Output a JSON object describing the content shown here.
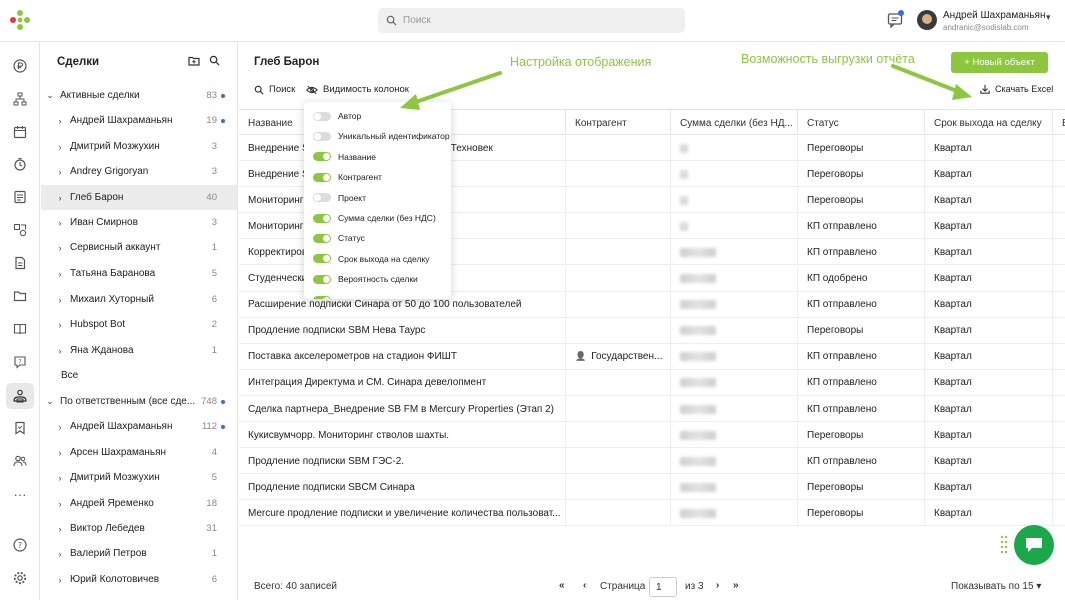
{
  "header": {
    "search_placeholder": "Поиск",
    "user_name": "Андрей Шахраманьян",
    "user_email": "andranic@sodislab.com"
  },
  "deals": {
    "title": "Сделки",
    "rows": [
      {
        "label": "Активные сделки",
        "count": "83",
        "dot": true,
        "expanded": true,
        "level": 0
      },
      {
        "label": "Андрей Шахраманьян",
        "count": "19",
        "dot": true,
        "level": 1
      },
      {
        "label": "Дмитрий Мозжухин",
        "count": "3",
        "dot": false,
        "level": 1
      },
      {
        "label": "Andrey Grigoryan",
        "count": "3",
        "dot": false,
        "level": 1
      },
      {
        "label": "Глеб Барон",
        "count": "40",
        "dot": false,
        "level": 1,
        "selected": true
      },
      {
        "label": "Иван Смирнов",
        "count": "3",
        "dot": false,
        "level": 1
      },
      {
        "label": "Сервисный аккаунт",
        "count": "1",
        "dot": false,
        "level": 1
      },
      {
        "label": "Татьяна Баранова",
        "count": "5",
        "dot": false,
        "level": 1
      },
      {
        "label": "Михаил Хуторный",
        "count": "6",
        "dot": false,
        "level": 1
      },
      {
        "label": "Hubspot Bot",
        "count": "2",
        "dot": false,
        "level": 1
      },
      {
        "label": "Яна Жданова",
        "count": "1",
        "dot": false,
        "level": 1
      },
      {
        "label": "Все",
        "count": "",
        "dot": false,
        "level": 2
      },
      {
        "label": "По ответственным (все сде...",
        "count": "748",
        "dot": true,
        "expanded": true,
        "level": 0
      },
      {
        "label": "Андрей Шахраманьян",
        "count": "112",
        "dot": true,
        "level": 1
      },
      {
        "label": "Арсен Шахраманьян",
        "count": "4",
        "dot": false,
        "level": 1
      },
      {
        "label": "Дмитрий Мозжухин",
        "count": "5",
        "dot": false,
        "level": 1
      },
      {
        "label": "Андрей Яременко",
        "count": "18",
        "dot": false,
        "level": 1
      },
      {
        "label": "Виктор Лебедев",
        "count": "31",
        "dot": false,
        "level": 1
      },
      {
        "label": "Валерий Петров",
        "count": "1",
        "dot": false,
        "level": 1
      },
      {
        "label": "Юрий Колотовичев",
        "count": "6",
        "dot": false,
        "level": 1
      }
    ]
  },
  "main": {
    "title": "Глеб Барон",
    "new_button": "+ Новый объект",
    "search_label": "Поиск",
    "columns_label": "Видимость колонок",
    "excel_label": "Скачать Excel",
    "columns": [
      "Название",
      "Контрагент",
      "Сумма сделки (без НД...",
      "Статус",
      "Срок выхода на сделку"
    ],
    "rows": [
      {
        "name": "Внедрение SB FM в Московский НИИ. НГО Техновек",
        "ctr": "",
        "sum": "short",
        "status": "Переговоры",
        "term": "Квартал"
      },
      {
        "name": "Внедрение SB FM",
        "ctr": "",
        "sum": "short",
        "status": "Переговоры",
        "term": "Квартал"
      },
      {
        "name": "Мониторинг",
        "ctr": "",
        "sum": "short",
        "status": "Переговоры",
        "term": "Квартал"
      },
      {
        "name": "Мониторинг вл. 21, стр.53-54, Бивер",
        "ctr": "",
        "sum": "short",
        "status": "КП отправлено",
        "term": "Квартал"
      },
      {
        "name": "Корректировка ела СМК по объекту «...",
        "ctr": "",
        "sum": "long",
        "status": "КП отправлено",
        "term": "Квартал"
      },
      {
        "name": "Студенческий проект",
        "ctr": "",
        "sum": "long",
        "status": "КП одобрено",
        "term": "Квартал"
      },
      {
        "name": "Расширение подписки Синара от 50 до 100 пользователей",
        "ctr": "",
        "sum": "long",
        "status": "КП отправлено",
        "term": "Квартал"
      },
      {
        "name": "Продление подписки SBM Нева Таурс",
        "ctr": "",
        "sum": "long",
        "status": "Переговоры",
        "term": "Квартал"
      },
      {
        "name": "Поставка акселерометров на стадион ФИШТ",
        "ctr": "Государствен...",
        "sum": "long",
        "status": "КП отправлено",
        "term": "Квартал"
      },
      {
        "name": "Интеграция Директума и СМ. Синара девелопмент",
        "ctr": "",
        "sum": "long",
        "status": "КП отправлено",
        "term": "Квартал"
      },
      {
        "name": "Сделка партнера_Внедрение SB FM в Mercury Properties (Этап 2)",
        "ctr": "",
        "sum": "long",
        "status": "КП отправлено",
        "term": "Квартал"
      },
      {
        "name": "Кукисвумчорр. Мониторинг стволов шахты.",
        "ctr": "",
        "sum": "long",
        "status": "Переговоры",
        "term": "Квартал"
      },
      {
        "name": "Продление подписки SBM ГЭС-2.",
        "ctr": "",
        "sum": "long",
        "status": "КП отправлено",
        "term": "Квартал"
      },
      {
        "name": "Продление подписки SBCM Синара",
        "ctr": "",
        "sum": "long",
        "status": "Переговоры",
        "term": "Квартал"
      },
      {
        "name": "Mercure продление подписки и увеличение количества пользоват...",
        "ctr": "",
        "sum": "long",
        "status": "Переговоры",
        "term": "Квартал"
      }
    ],
    "footer": {
      "total": "Всего: 40 записей",
      "page_label": "Страница",
      "page_value": "1",
      "page_of": "из 3",
      "per_page": "Показывать по 15"
    }
  },
  "popup": {
    "items": [
      {
        "label": "Автор",
        "on": false
      },
      {
        "label": "Уникальный идентификатор",
        "on": false
      },
      {
        "label": "Название",
        "on": true
      },
      {
        "label": "Контрагент",
        "on": true
      },
      {
        "label": "Проект",
        "on": false
      },
      {
        "label": "Сумма сделки (без НДС)",
        "on": true
      },
      {
        "label": "Статус",
        "on": true
      },
      {
        "label": "Срок выхода на сделку",
        "on": true
      },
      {
        "label": "Вероятность сделки",
        "on": true
      }
    ]
  },
  "annotations": {
    "display_settings": "Настройка отображения",
    "export": "Возможность выгрузки отчёта"
  },
  "colors": {
    "accent": "#8dc63f",
    "dot": "#2f6fe0",
    "fab": "#1aa84a"
  }
}
